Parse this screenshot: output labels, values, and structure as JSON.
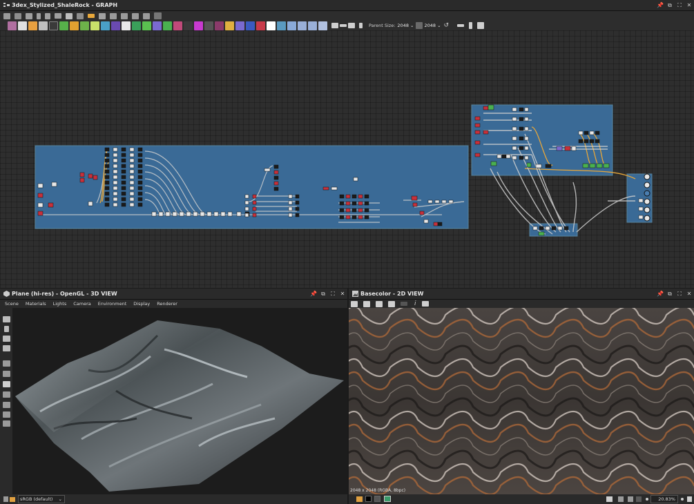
{
  "graph": {
    "title": "3dex_Stylized_ShaleRock - GRAPH",
    "toolbar": {
      "parent_size_label": "Parent Size:",
      "parent_size_value": "2048",
      "output_size_value": "2048"
    }
  },
  "view3d": {
    "title": "Plane (hi-res) - OpenGL - 3D VIEW",
    "menu": [
      "Scene",
      "Materials",
      "Lights",
      "Camera",
      "Environment",
      "Display",
      "Renderer"
    ],
    "colorspace": "sRGB (default)"
  },
  "view2d": {
    "title": "Basecolor - 2D VIEW",
    "image_info": "2048 x 2048 (RGBA, 8bpc)",
    "zoom": "20.83%"
  },
  "icons": {
    "window": [
      "pin-icon",
      "float-icon",
      "maximize-icon",
      "close-icon"
    ]
  },
  "colors": {
    "frame": "#3a6a96",
    "accent": "#4a7eb0"
  }
}
